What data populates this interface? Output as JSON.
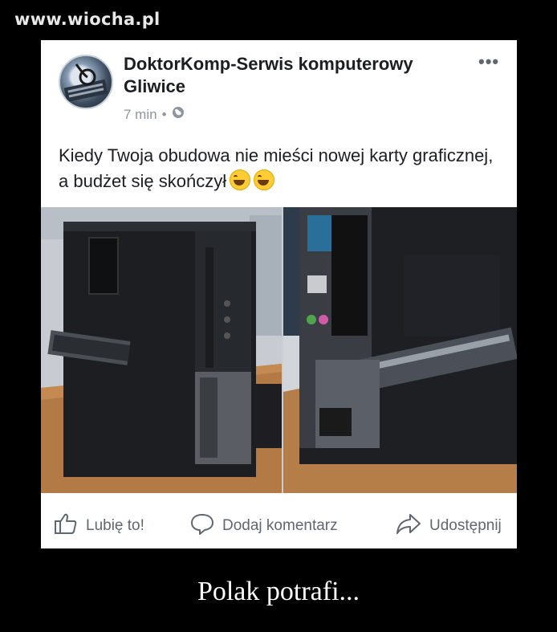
{
  "watermark": "www.wiocha.pl",
  "post": {
    "author_line1": "DoktorKomp-Serwis komputerowy",
    "author_line2": "Gliwice",
    "time": "7 min",
    "separator": "•",
    "text": "Kiedy Twoja obudowa nie mieści nowej karty graficznej, a budżet się skończył",
    "emoji": [
      "tears-of-joy-emoji",
      "tears-of-joy-emoji"
    ]
  },
  "actions": {
    "like": "Lubię to!",
    "comment": "Dodaj komentarz",
    "share": "Udostępnij"
  },
  "caption": "Polak potrafi..."
}
